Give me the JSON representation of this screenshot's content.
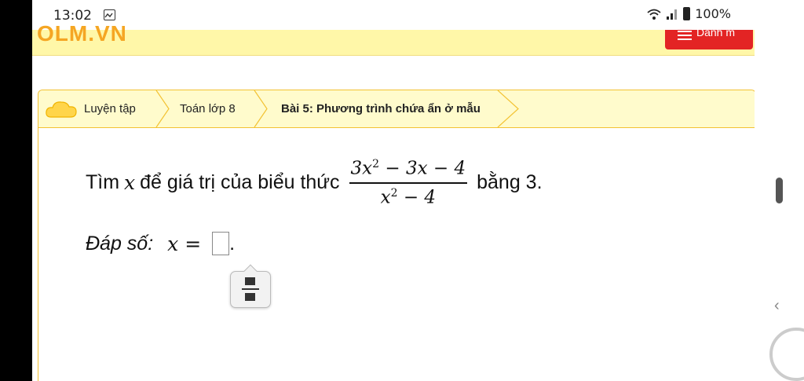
{
  "status_bar": {
    "time": "13:02",
    "battery": "100%",
    "icons": [
      "gallery-icon",
      "wifi-icon",
      "signal-icon",
      "battery-icon"
    ]
  },
  "header": {
    "logo_text": "OLM.VN",
    "menu_label": "Danh m"
  },
  "breadcrumb": {
    "items": [
      "Luyện tập",
      "Toán lớp 8",
      "Bài 5: Phương trình chứa ẩn ở mẫu"
    ]
  },
  "question": {
    "prefix": "Tìm",
    "variable": "x",
    "middle": "để giá trị của biểu thức",
    "numerator_lead": "3x",
    "numerator_exp": "2",
    "numerator_tail": " − 3x − 4",
    "denominator_lead": "x",
    "denominator_exp": "2",
    "denominator_tail": " − 4",
    "suffix": "bằng 3."
  },
  "answer": {
    "label": "Đáp số:",
    "equation": "x =",
    "period": "."
  },
  "colors": {
    "header_bg": "#fff7a8",
    "breadcrumb_bg": "#fffbcc",
    "accent_border": "#f3c232",
    "menu_red": "#e32424",
    "logo_orange": "#f5a623"
  }
}
